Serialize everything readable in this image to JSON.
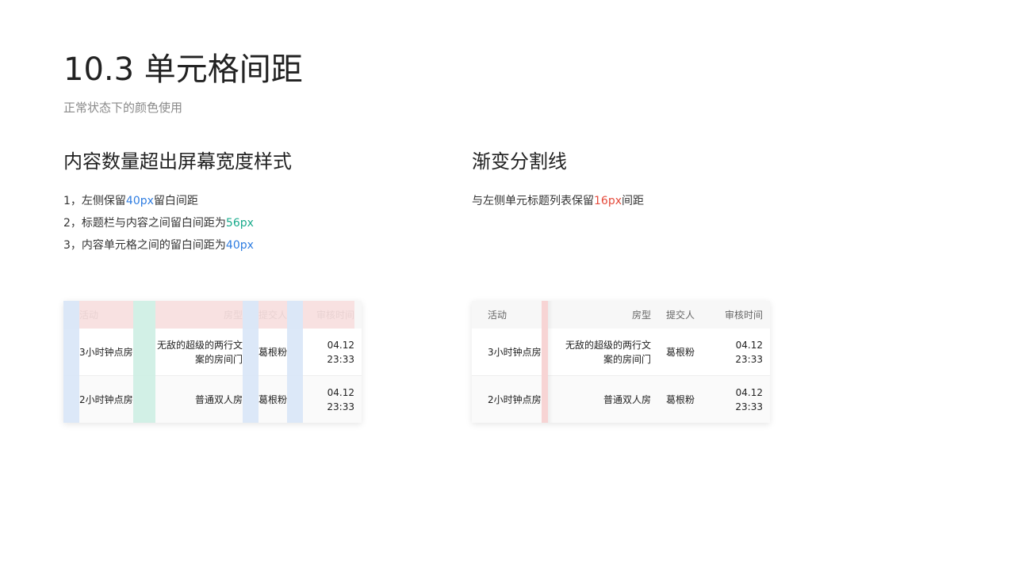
{
  "page": {
    "title": "10.3 单元格间距",
    "subtitle": "正常状态下的颜色使用"
  },
  "left_section": {
    "title": "内容数量超出屏幕宽度样式",
    "notes": [
      {
        "prefix": "1，左侧保留",
        "value": "40px",
        "suffix": "留白间距",
        "value_color": "#2f7de1"
      },
      {
        "prefix": "2，标题栏与内容之间留白间距为",
        "value": "56px",
        "suffix": "",
        "value_color": "#1aab8c"
      },
      {
        "prefix": "3，内容单元格之间的留白间距为",
        "value": "40px",
        "suffix": "",
        "value_color": "#2f7de1"
      }
    ]
  },
  "right_section": {
    "title": "渐变分割线",
    "note": {
      "prefix": "与左侧单元标题列表保留",
      "value": "16px",
      "suffix": "间距",
      "value_color": "#e54b3c"
    }
  },
  "table": {
    "headers": [
      "活动",
      "房型",
      "提交人",
      "审核时间"
    ],
    "rows": [
      [
        "3小时钟点房",
        "无敌的超级的两行文案的房间门",
        "葛根粉",
        "04.12 23:33"
      ],
      [
        "2小时钟点房",
        "普通双人房",
        "葛根粉",
        "04.12 23:33"
      ]
    ]
  },
  "colors": {
    "overlay_blue": "#d6e4f7",
    "overlay_green": "#cdeee3",
    "overlay_pink": "#f7dede",
    "overlay_red": "#f7d2d2"
  }
}
